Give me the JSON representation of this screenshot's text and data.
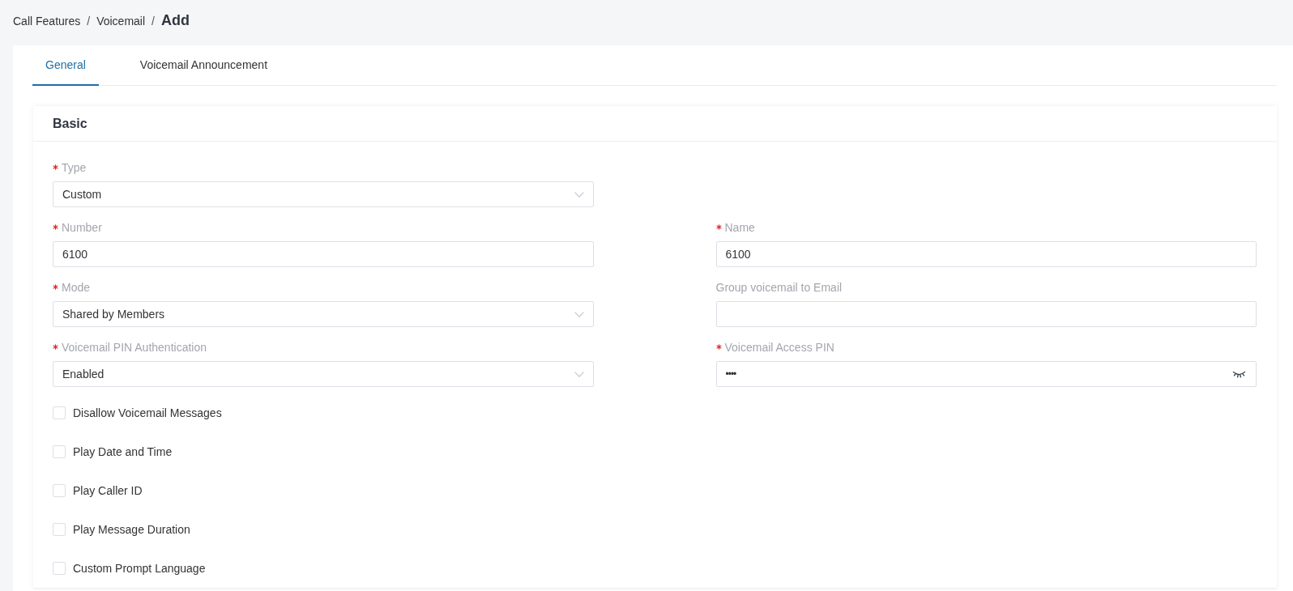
{
  "breadcrumb": [
    {
      "kind": "link",
      "label": "Call Features"
    },
    {
      "kind": "separator",
      "label": "/"
    },
    {
      "kind": "link",
      "label": "Voicemail"
    },
    {
      "kind": "separator",
      "label": "/"
    },
    {
      "kind": "current",
      "label": "Add"
    }
  ],
  "tabs": [
    {
      "label": "General",
      "selected": true
    },
    {
      "label": "Voicemail Announcement",
      "selected": false
    }
  ],
  "section": {
    "title": "Basic",
    "rows": [
      {
        "fields": [
          {
            "kind": "select",
            "label": "Type",
            "required": true,
            "value": "Custom"
          }
        ]
      },
      {
        "fields": [
          {
            "kind": "text",
            "label": "Number",
            "required": true,
            "value": "6100"
          },
          {
            "kind": "text",
            "label": "Name",
            "required": true,
            "value": "6100"
          }
        ]
      },
      {
        "fields": [
          {
            "kind": "select",
            "label": "Mode",
            "required": true,
            "value": "Shared by Members"
          },
          {
            "kind": "text",
            "label": "Group voicemail to Email",
            "required": false
          }
        ]
      },
      {
        "fields": [
          {
            "kind": "select",
            "label": "Voicemail PIN Authentication",
            "required": true,
            "value": "Enabled"
          },
          {
            "kind": "password",
            "label": "Voicemail Access PIN",
            "required": true,
            "value": "••••"
          }
        ]
      }
    ],
    "checkboxes": [
      {
        "label": "Disallow Voicemail Messages",
        "checked": false
      },
      {
        "label": "Play Date and Time",
        "checked": false
      },
      {
        "label": "Play Caller ID",
        "checked": false
      },
      {
        "label": "Play Message Duration",
        "checked": false
      },
      {
        "label": "Custom Prompt Language",
        "checked": false
      }
    ]
  }
}
